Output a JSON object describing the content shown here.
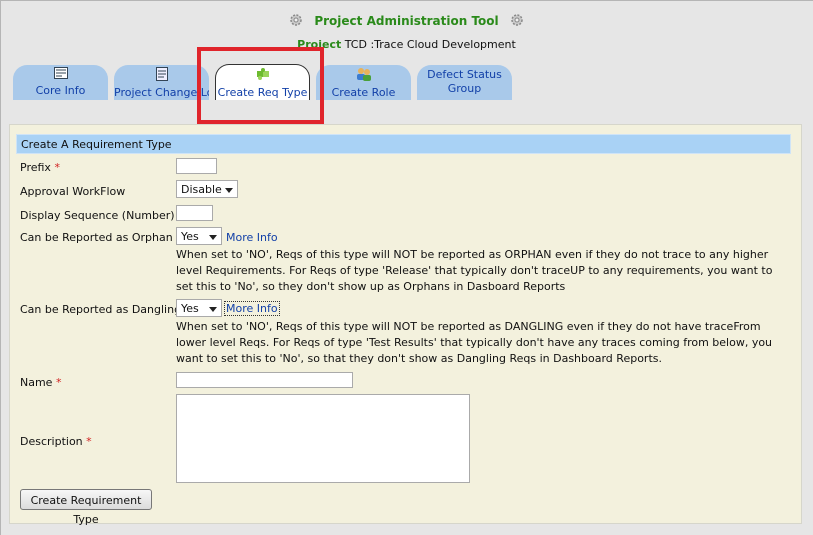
{
  "header": {
    "title": "Project Administration Tool",
    "project_label": "Project",
    "project_name": "TCD :Trace Cloud Development"
  },
  "tabs": [
    {
      "label": "Core Info",
      "icon": "form-icon"
    },
    {
      "label": "Project Change Log",
      "icon": "document-icon"
    },
    {
      "label": "Create Req Type",
      "icon": "puzzle-icon",
      "active": true
    },
    {
      "label": "Create Role",
      "icon": "users-icon"
    },
    {
      "label": "Defect Status Group",
      "icon": ""
    }
  ],
  "form": {
    "section_title": "Create A Requirement Type",
    "prefix_label": "Prefix",
    "approval_label": "Approval WorkFlow",
    "approval_value": "Disable",
    "display_seq_label": "Display Sequence (Number)",
    "orphan_label": "Can be Reported as Orphan",
    "orphan_value": "Yes",
    "orphan_more": "More Info",
    "orphan_help": "When set to 'NO', Reqs of this type will NOT be reported as ORPHAN even if they do not trace to any higher level Requirements. For Reqs of type 'Release' that typically don't traceUP to any requirements, you want to set this to 'No', so they don't show up as Orphans in Dasboard Reports",
    "dangling_label": "Can be Reported as Dangling",
    "dangling_value": "Yes",
    "dangling_more": "More Info",
    "dangling_help": "When set to 'NO', Reqs of this type will NOT be reported as DANGLING even if they do not have traceFrom lower level Reqs. For Reqs of type 'Test Results' that typically don't have any traces coming from below, you want to set this to 'No', so that they don't show as Dangling Reqs in Dashboard Reports.",
    "name_label": "Name",
    "description_label": "Description",
    "required_mark": "*",
    "submit_label": "Create Requirement Type"
  },
  "colors": {
    "title_green": "#2a8a1a",
    "tab_blue": "#a9c9ea",
    "link_blue": "#1240a8",
    "panel_bg": "#f3f1dd",
    "section_bar": "#a9d2f5",
    "highlight_red": "#e0242b",
    "required_red": "#d02020"
  }
}
